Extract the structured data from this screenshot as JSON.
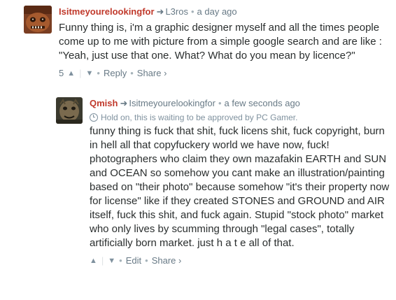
{
  "comments": [
    {
      "author": "Isitmeyourelookingfor",
      "reply_to": "L3ros",
      "time": "a day ago",
      "text": "Funny thing is, i'm a graphic designer myself and all the times people come up to me with picture from a simple google search and are like : \"Yeah, just use that one. What? What do you mean by licence?\"",
      "upvotes": "5",
      "upvote_icon": "▲",
      "downvote_icon": "▼",
      "actions": [
        "Reply",
        "Share ›"
      ]
    },
    {
      "author": "Qmish",
      "reply_to": "Isitmeyourelookingfor",
      "time": "a few seconds ago",
      "pending_notice": "Hold on, this is waiting to be approved by PC Gamer.",
      "text": "funny thing is fuck that shit, fuck licens shit, fuck copyright, burn in hell all that copyfuckery world we have now, fuck! photographers who claim they own mazafakin EARTH and SUN and OCEAN so somehow you cant make an illustration/painting based on \"their photo\" because somehow \"it's their property now for license\" like if they created STONES and GROUND and AIR itself, fuck this shit, and fuck again. Stupid \"stock photo\" market who only lives by scumming through \"legal cases\", totally artificially born market. just h a t e all of that.",
      "upvote_icon": "▲",
      "downvote_icon": "▼",
      "actions": [
        "Edit",
        "Share ›"
      ]
    }
  ],
  "ui": {
    "reply_arrow": "➜",
    "meta_dot": "•",
    "action_dot": "•"
  },
  "colors": {
    "author": "#c0392b",
    "muted": "#687a86",
    "text": "#2a2e2e"
  }
}
